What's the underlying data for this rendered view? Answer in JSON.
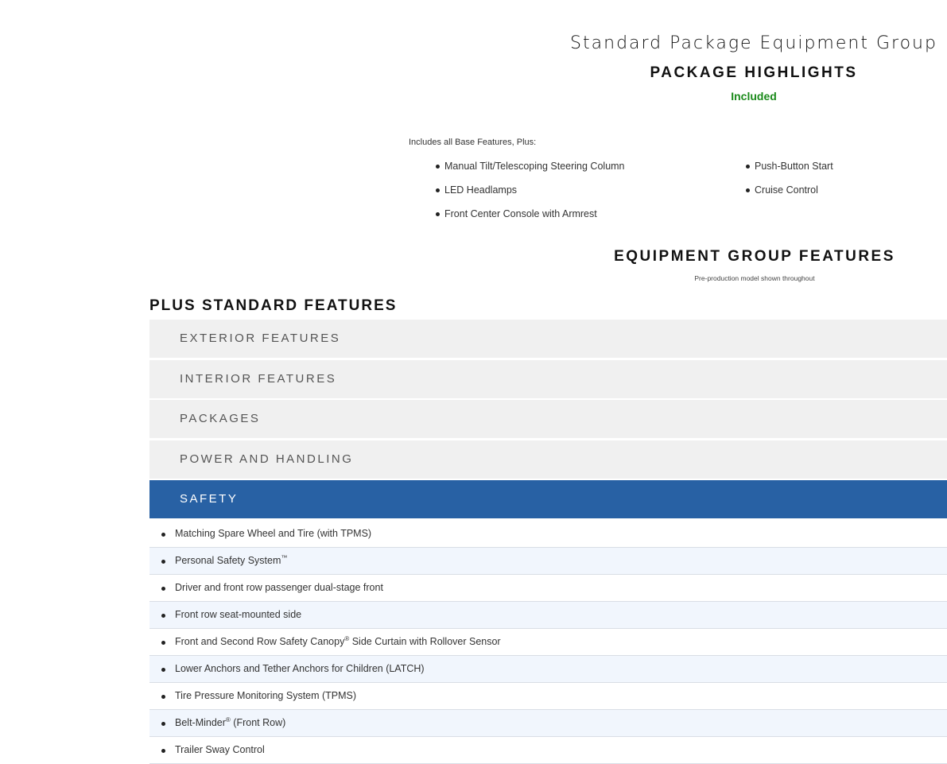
{
  "package": {
    "name": "Standard Package Equipment Group",
    "highlights_title": "PACKAGE HIGHLIGHTS",
    "price_status": "Included",
    "includes_intro": "Includes all Base Features, Plus:",
    "highlights_col1": [
      "Manual Tilt/Telescoping Steering Column",
      "LED Headlamps",
      "Front Center Console with Armrest"
    ],
    "highlights_col2": [
      "Push-Button Start",
      "Cruise Control"
    ]
  },
  "equipment": {
    "title": "EQUIPMENT GROUP FEATURES",
    "note": "Pre-production model shown throughout"
  },
  "standard": {
    "title": "PLUS STANDARD FEATURES",
    "sections": [
      {
        "label": "EXTERIOR FEATURES"
      },
      {
        "label": "INTERIOR FEATURES"
      },
      {
        "label": "PACKAGES"
      },
      {
        "label": "POWER AND HANDLING"
      },
      {
        "label": "SAFETY"
      }
    ],
    "safety_items": [
      {
        "text": "Matching Spare Wheel and Tire (with TPMS)"
      },
      {
        "text": "Personal Safety System",
        "mark": "™"
      },
      {
        "text": "Driver and front row passenger dual-stage front"
      },
      {
        "text": "Front row seat-mounted side"
      },
      {
        "text": "Front and Second Row Safety Canopy",
        "mark": "®",
        "rest": " Side Curtain with Rollover Sensor"
      },
      {
        "text": "Lower Anchors and Tether Anchors for Children (LATCH)"
      },
      {
        "text": "Tire Pressure Monitoring System (TPMS)"
      },
      {
        "text": "Belt-Minder",
        "mark": "®",
        "rest": " (Front Row)"
      },
      {
        "text": "Trailer Sway Control"
      }
    ]
  },
  "colors": {
    "included_green": "#1a8a1a",
    "active_section_blue": "#2861a4",
    "section_gray": "#f0f0f0",
    "alt_row_tint": "#f1f6fd"
  }
}
